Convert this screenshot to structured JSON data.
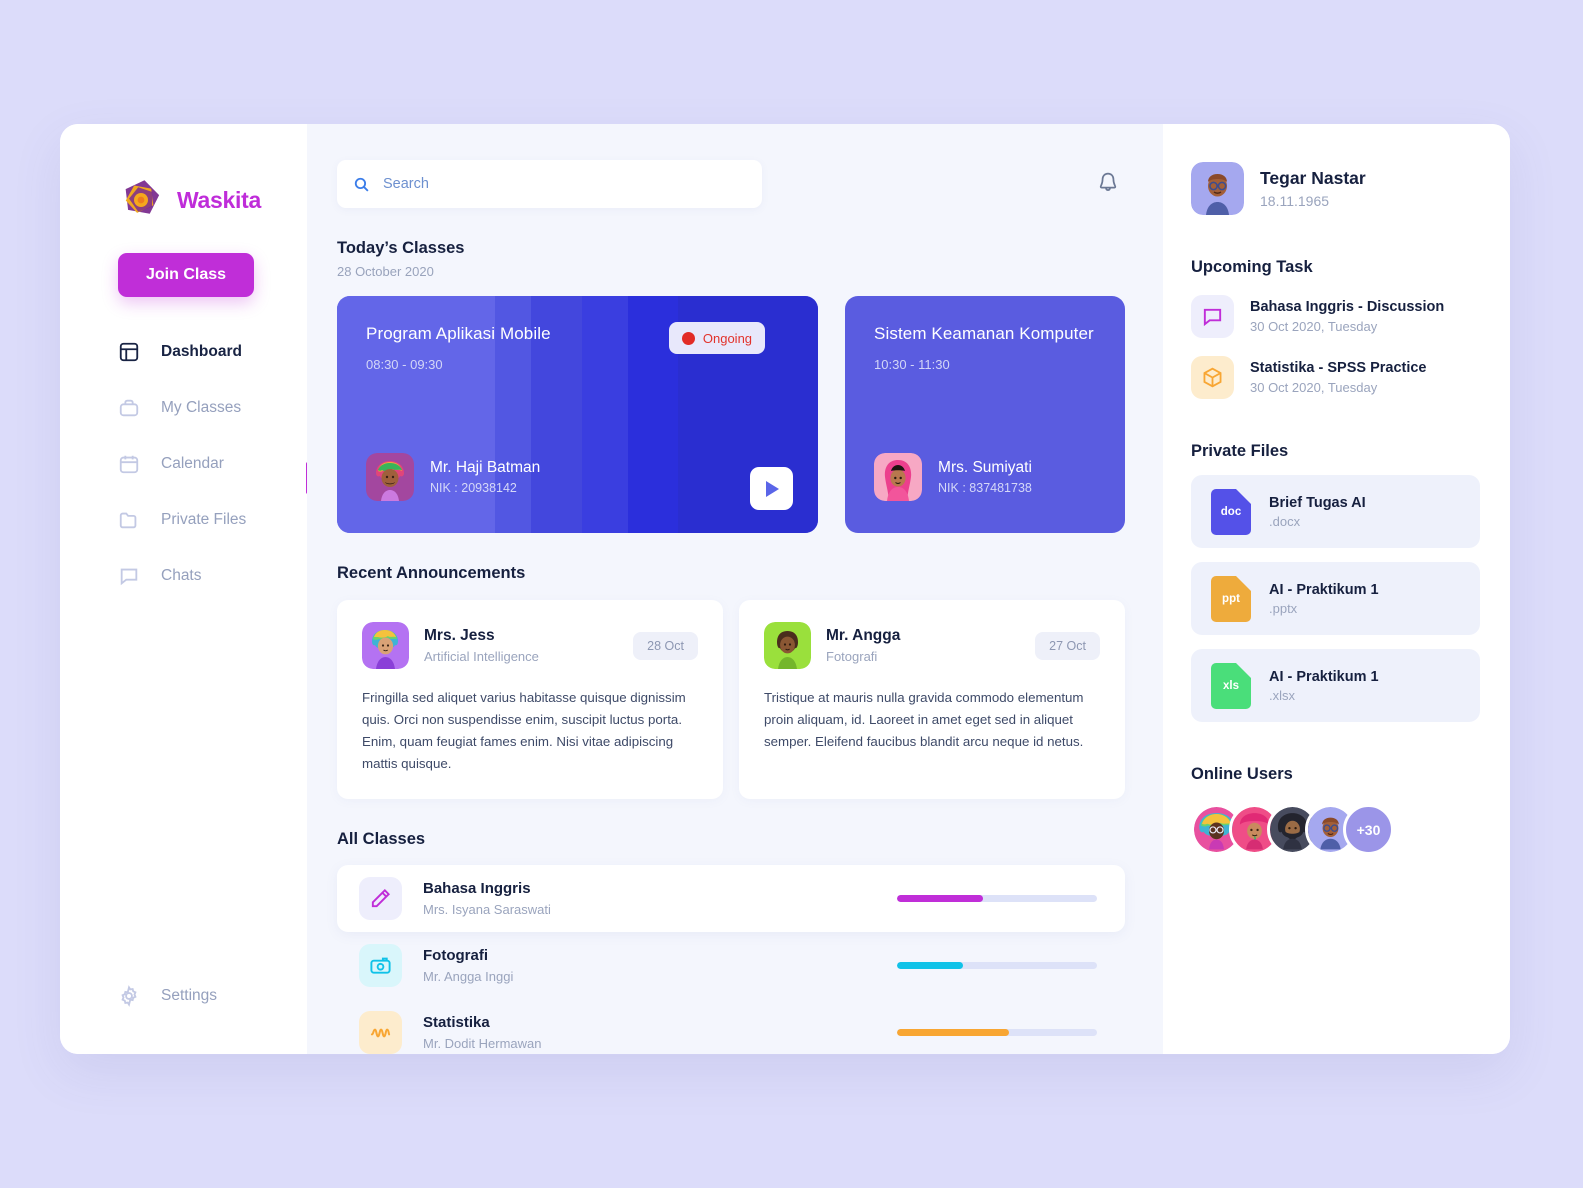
{
  "brand": {
    "name": "Waskita",
    "logo_icon": "waskita-logo-icon"
  },
  "sidebar": {
    "join_button": "Join Class",
    "items": [
      {
        "label": "Dashboard",
        "icon": "dashboard-icon",
        "active": true
      },
      {
        "label": "My Classes",
        "icon": "briefcase-icon",
        "active": false
      },
      {
        "label": "Calendar",
        "icon": "calendar-icon",
        "active": false
      },
      {
        "label": "Private Files",
        "icon": "folder-icon",
        "active": false
      },
      {
        "label": "Chats",
        "icon": "chat-bubble-icon",
        "active": false
      }
    ],
    "settings": {
      "label": "Settings",
      "icon": "gear-icon"
    }
  },
  "topbar": {
    "search_placeholder": "Search",
    "search_value": "",
    "search_icon": "search-icon",
    "bell_icon": "bell-icon"
  },
  "todays_classes": {
    "title": "Today’s Classes",
    "date": "28 October 2020",
    "cards": [
      {
        "title": "Program Aplikasi Mobile",
        "time": "08:30 - 09:30",
        "teacher": "Mr. Haji Batman",
        "nik": "NIK : 20938142",
        "status_label": "Ongoing",
        "status_color": "#e2322b",
        "has_play": true
      },
      {
        "title": "Sistem Keamanan Komputer",
        "time": "10:30 - 11:30",
        "teacher": "Mrs. Sumiyati",
        "nik": "NIK : 837481738",
        "status_label": "",
        "has_play": false
      }
    ]
  },
  "announcements": {
    "title": "Recent Announcements",
    "items": [
      {
        "author": "Mrs. Jess",
        "subject": "Artificial Intelligence",
        "date": "28 Oct",
        "body": "Fringilla sed aliquet varius habitasse quisque dignissim quis. Orci non suspendisse enim, suscipit luctus porta. Enim, quam feugiat fames enim. Nisi vitae adipiscing mattis quisque."
      },
      {
        "author": "Mr. Angga",
        "subject": "Fotografi",
        "date": "27 Oct",
        "body": "Tristique at mauris nulla gravida commodo elementum proin aliquam, id. Laoreet in amet eget sed in aliquet semper. Eleifend faucibus blandit arcu neque id netus."
      }
    ]
  },
  "all_classes": {
    "title": "All Classes",
    "items": [
      {
        "name": "Bahasa Inggris",
        "teacher": "Mrs. Isyana Saraswati",
        "icon": "pencil-icon",
        "icon_color": "#c02ed8",
        "icon_bg": "#eeeefc",
        "progress": 43,
        "progress_color": "#c02ed8",
        "active": true
      },
      {
        "name": "Fotografi",
        "teacher": "Mr. Angga Inggi",
        "icon": "camera-icon",
        "icon_color": "#10c2e8",
        "icon_bg": "#d9f6fb",
        "progress": 33,
        "progress_color": "#10c2e8",
        "active": false
      },
      {
        "name": "Statistika",
        "teacher": "Mr. Dodit Hermawan",
        "icon": "wave-icon",
        "icon_color": "#f8a633",
        "icon_bg": "#fdeccd",
        "progress": 56,
        "progress_color": "#f8a633",
        "active": false
      }
    ]
  },
  "profile": {
    "name": "Tegar Nastar",
    "dob": "18.11.1965",
    "chevron_icon": "chevron-down-icon",
    "avatar_icon": "avatar"
  },
  "upcoming_task": {
    "title": "Upcoming Task",
    "arrow_icon": "arrow-right-icon",
    "items": [
      {
        "name": "Bahasa Inggris - Discussion",
        "date": "30 Oct 2020, Tuesday",
        "icon": "chat-bubble-icon",
        "icon_color": "#c02ed8",
        "icon_bg": "#eeeefc"
      },
      {
        "name": "Statistika - SPSS Practice",
        "date": "30 Oct 2020, Tuesday",
        "icon": "cube-icon",
        "icon_color": "#f8a633",
        "icon_bg": "#fdeccd"
      }
    ]
  },
  "private_files": {
    "title": "Private Files",
    "arrow_icon": "arrow-right-icon",
    "items": [
      {
        "name": "Brief Tugas AI",
        "ext": ".docx",
        "badge": "doc",
        "color": "#5451e8",
        "download_icon": "download-file-icon"
      },
      {
        "name": "AI - Praktikum 1",
        "ext": ".pptx",
        "badge": "ppt",
        "color": "#eeab3c",
        "download_icon": "download-file-icon"
      },
      {
        "name": "AI - Praktikum 1",
        "ext": ".xlsx",
        "badge": "xls",
        "color": "#4ade7a",
        "download_icon": "download-file-icon"
      }
    ]
  },
  "online_users": {
    "title": "Online Users",
    "more_label": "+30",
    "avatars": [
      "avatar-rainbow",
      "avatar-pink-cap",
      "avatar-dark-beard",
      "avatar-glasses"
    ]
  },
  "colors": {
    "accent": "#c02ed8",
    "card_blue": "#5a5ce0",
    "page_bg": "#dcdcfa",
    "main_bg": "#f4f6fd"
  }
}
